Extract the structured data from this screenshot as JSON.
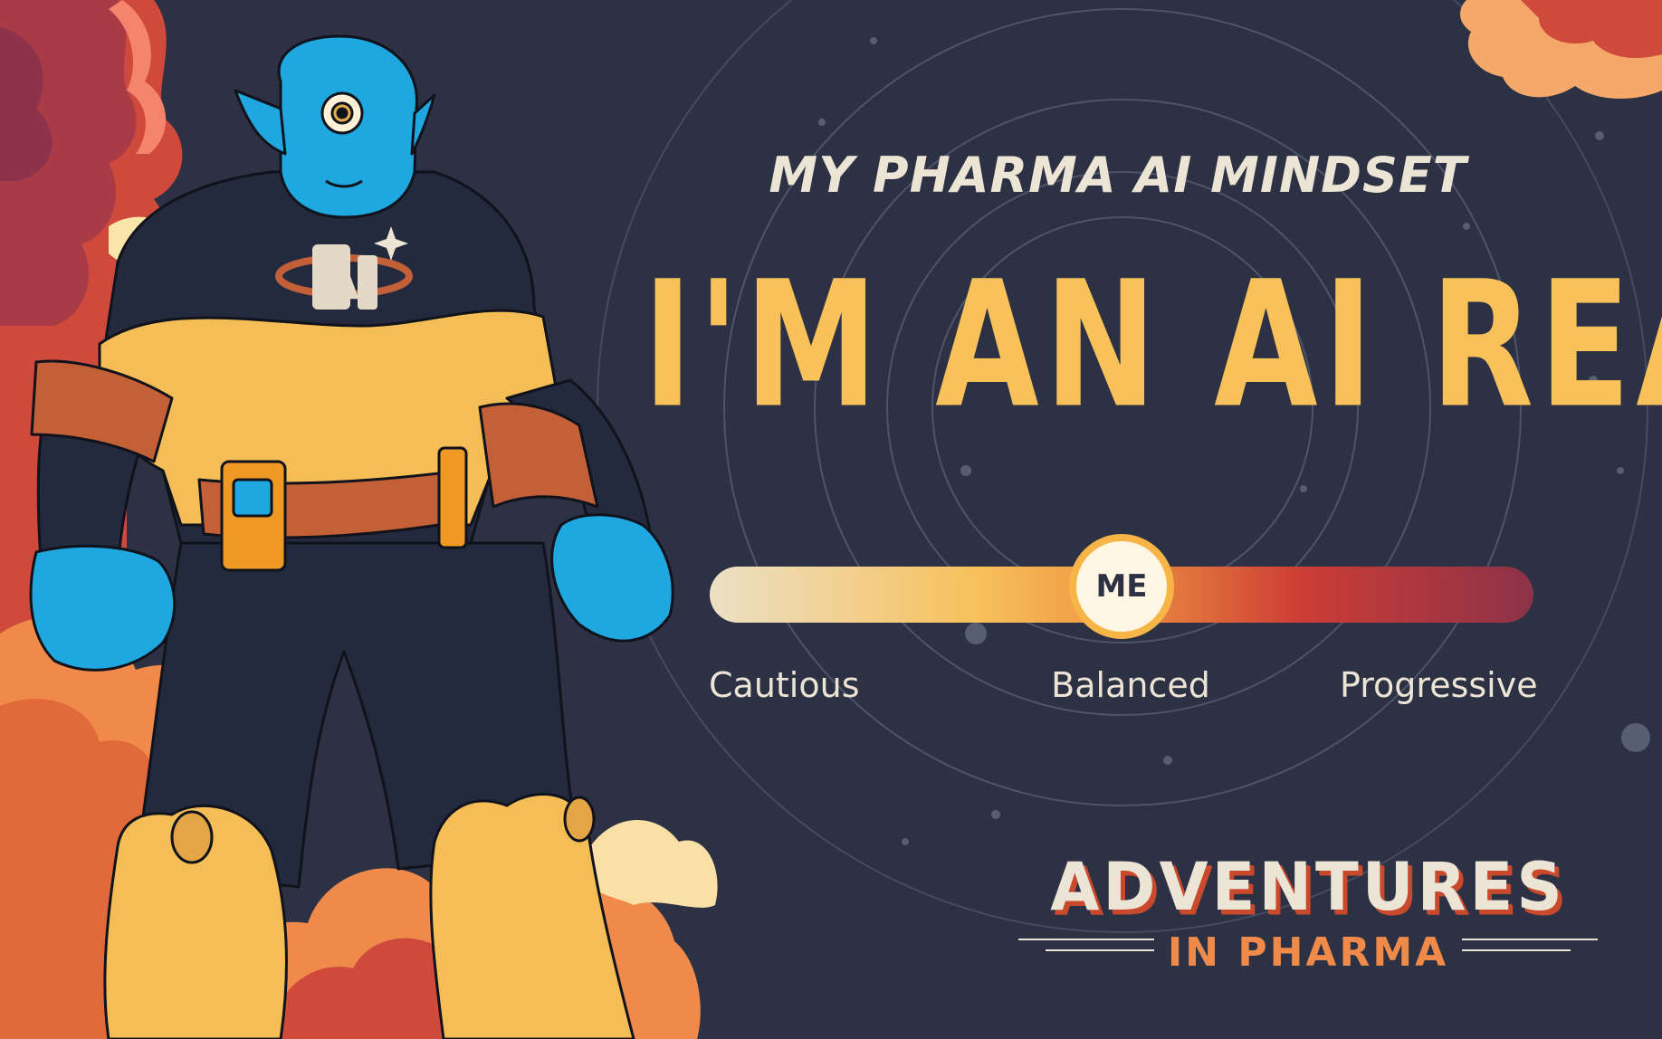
{
  "card": {
    "subtitle": "MY PHARMA AI MINDSET",
    "headline": "I'M AN AI REALIST"
  },
  "mindset_slider": {
    "marker_label": "ME",
    "position_fraction": 0.5,
    "labels": {
      "left": "Cautious",
      "middle": "Balanced",
      "right": "Progressive"
    }
  },
  "logo": {
    "line1": "ADVENTURES",
    "line2": "IN PHARMA"
  },
  "hero": {
    "chest_emblem": "AI"
  },
  "colors": {
    "background": "#2c3144",
    "headline": "#f8c15a",
    "text_light": "#ece4d4",
    "hero_skin": "#1fa7e0",
    "hero_suit": "#242a3d",
    "hero_gold": "#f5bd55",
    "cloud_red": "#cf4a3d",
    "cloud_orange": "#ef8a4a"
  }
}
